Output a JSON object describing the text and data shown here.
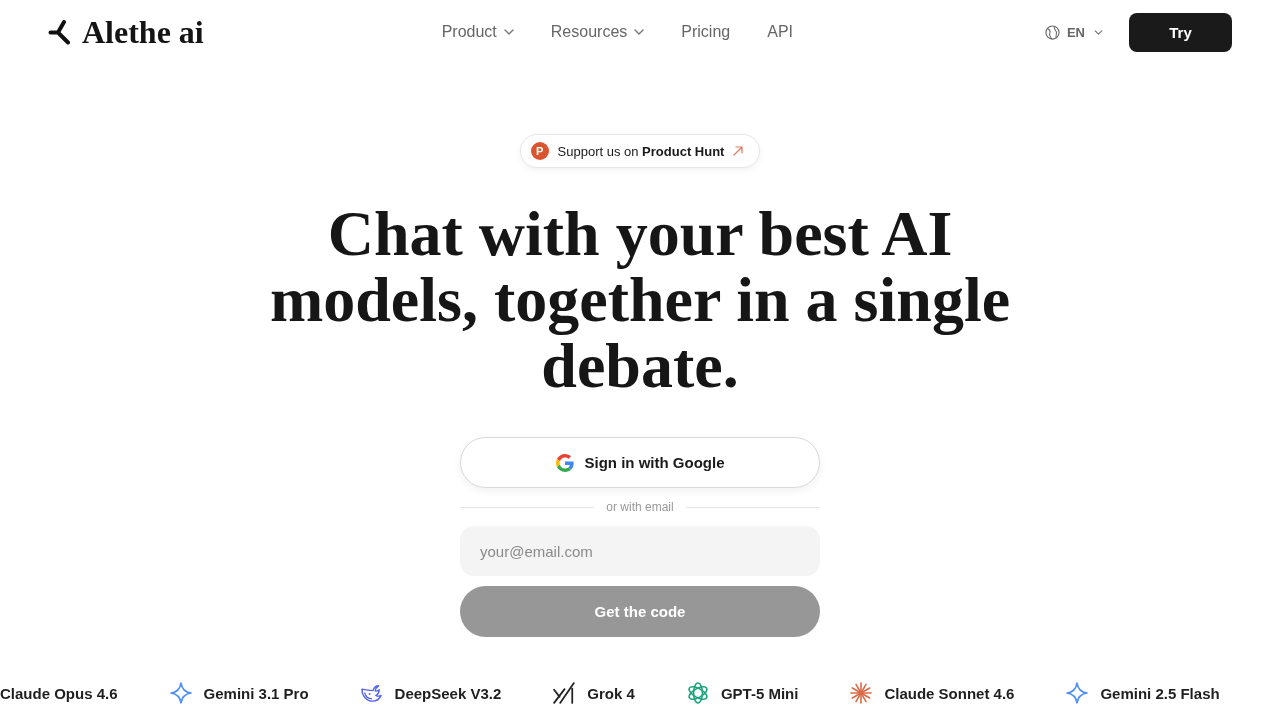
{
  "header": {
    "logo": "Alethe ai",
    "nav": [
      {
        "label": "Product",
        "menu": true
      },
      {
        "label": "Resources",
        "menu": true
      },
      {
        "label": "Pricing",
        "menu": false
      },
      {
        "label": "API",
        "menu": false
      }
    ],
    "language": "EN",
    "cta": "Try"
  },
  "hero": {
    "badge": {
      "icon_letter": "P",
      "text": "Support us on **Product Hunt**"
    },
    "headline": "Chat with your best AI models, together in a single debate."
  },
  "signin": {
    "google_button": "Sign in with Google",
    "divider": "or with email",
    "email": {
      "placeholder": "your@email.com"
    },
    "submit": {
      "label": "Get the code",
      "disabled": true
    }
  },
  "models": [
    {
      "name": "Claude Opus 4.6",
      "kind": "cropped"
    },
    {
      "name": "Gemini 3.1 Pro",
      "kind": "sparkle"
    },
    {
      "name": "DeepSeek V3.2",
      "kind": "whale"
    },
    {
      "name": "Grok 4",
      "kind": "slashes"
    },
    {
      "name": "GPT-5 Mini",
      "kind": "knot"
    },
    {
      "name": "Claude Sonnet 4.6",
      "kind": "starburst"
    },
    {
      "name": "Gemini 2.5 Flash",
      "kind": "sparkle"
    }
  ]
}
